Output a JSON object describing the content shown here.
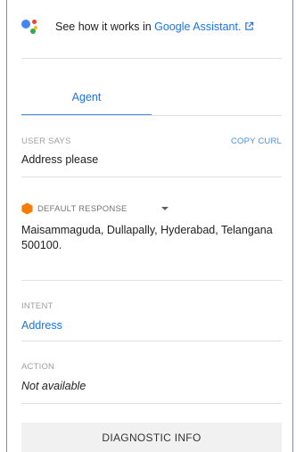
{
  "assistant": {
    "prefix": "See how it works in ",
    "link": "Google Assistant."
  },
  "tabs": [
    {
      "label": "Agent"
    }
  ],
  "user_says": {
    "label": "USER SAYS",
    "copy_label": "COPY CURL",
    "value": "Address please"
  },
  "default_response": {
    "label": "DEFAULT RESPONSE",
    "text": "Maisammaguda, Dullapally, Hyderabad, Telangana 500100."
  },
  "intent": {
    "label": "INTENT",
    "value": "Address"
  },
  "action": {
    "label": "ACTION",
    "value": "Not available"
  },
  "diagnostic": {
    "label": "DIAGNOSTIC INFO"
  },
  "colors": {
    "link": "#1a73e8",
    "tab_underline": "#4a90e2",
    "response_icon": "#f57c00",
    "border": "#7a8ea8"
  }
}
